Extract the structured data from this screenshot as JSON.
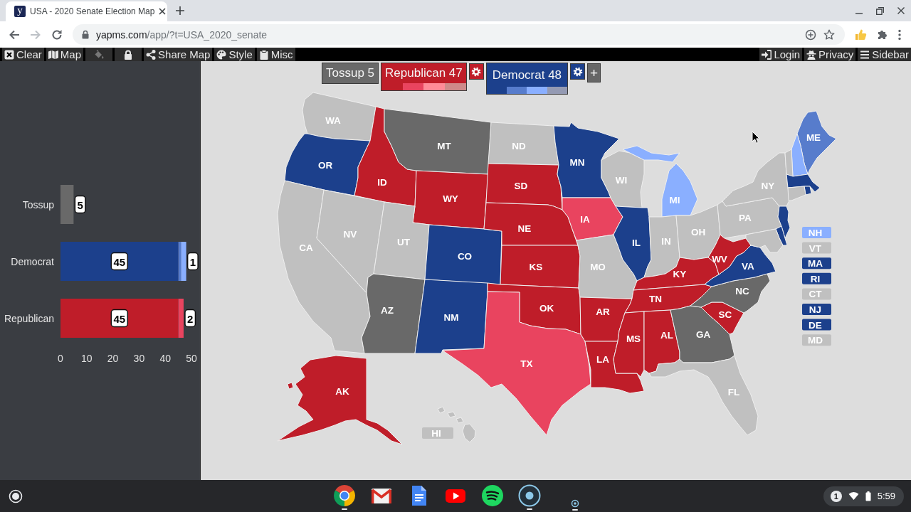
{
  "browser": {
    "tab": {
      "favicon_text": "y",
      "title": "USA - 2020 Senate Election Map"
    },
    "url_host": "yapms.com",
    "url_path": "/app/?t=USA_2020_senate"
  },
  "toolbar": {
    "left": [
      {
        "label": "Clear",
        "disabled": false
      },
      {
        "label": "Map",
        "disabled": false
      },
      {
        "disabled": true
      },
      {
        "disabled": false
      },
      {
        "label": "Share Map",
        "disabled": false
      },
      {
        "label": "Style",
        "disabled": false
      },
      {
        "label": "Misc",
        "disabled": false
      }
    ],
    "right": [
      {
        "label": "Login",
        "disabled": false
      },
      {
        "label": "Privacy",
        "disabled": false
      },
      {
        "label": "Sidebar",
        "disabled": false
      }
    ]
  },
  "sidebar": {
    "chart_data": {
      "type": "bar",
      "orientation": "horizontal",
      "stacked": true,
      "categories": [
        "Tossup",
        "Democrat",
        "Republican"
      ],
      "series": [
        {
          "color": "#696969",
          "values": [
            5,
            null,
            null
          ]
        },
        {
          "color": "#1c408c",
          "values": [
            null,
            45,
            null
          ]
        },
        {
          "color": "#577ccc",
          "values": [
            null,
            1,
            null
          ]
        },
        {
          "color": "#8aafff",
          "values": [
            null,
            2,
            null
          ]
        },
        {
          "color": "#bf1d29",
          "values": [
            null,
            null,
            45
          ]
        },
        {
          "color": "#e9445f",
          "values": [
            null,
            null,
            2
          ]
        }
      ],
      "xlim": [
        0,
        50
      ],
      "xticks": [
        0,
        10,
        20,
        30,
        40,
        50
      ],
      "value_labels": [
        [
          "5",
          null,
          null
        ],
        [
          null,
          "45",
          null
        ],
        [
          null,
          "1",
          null
        ],
        [
          null,
          null,
          null
        ],
        [
          null,
          null,
          "45"
        ],
        [
          null,
          null,
          "2"
        ]
      ]
    }
  },
  "map": {
    "legend": {
      "parties": [
        {
          "label": "Tossup 5",
          "color": "#696969",
          "selected": false,
          "settings": false
        },
        {
          "label": "Republican 47",
          "color": "#bf1d29",
          "selected": false,
          "settings": true,
          "swatches": [
            {
              "color": "#e9445f"
            },
            {
              "color": "#ff8b98"
            },
            {
              "color": "#cf8a8a"
            }
          ]
        },
        {
          "label": "Democrat 48",
          "color": "#1c408c",
          "selected": true,
          "settings": true,
          "swatches": [
            {
              "color": "#577ccc"
            },
            {
              "color": "#8aafff"
            },
            {
              "color": "#949ab3"
            }
          ]
        }
      ],
      "add_button": "+"
    },
    "states": [
      {
        "label": "WA",
        "color": "#c0c0c0",
        "kind": "inline"
      },
      {
        "label": "OR",
        "color": "#1c408c",
        "kind": "inline"
      },
      {
        "label": "CA",
        "color": "#c0c0c0",
        "kind": "inline"
      },
      {
        "label": "ID",
        "color": "#bf1d29",
        "kind": "inline"
      },
      {
        "label": "NV",
        "color": "#c0c0c0",
        "kind": "inline"
      },
      {
        "label": "MT",
        "color": "#696969",
        "kind": "inline"
      },
      {
        "label": "WY",
        "color": "#bf1d29",
        "kind": "inline"
      },
      {
        "label": "UT",
        "color": "#c0c0c0",
        "kind": "inline"
      },
      {
        "label": "AZ",
        "color": "#696969",
        "kind": "inline"
      },
      {
        "label": "CO",
        "color": "#1c408c",
        "kind": "inline"
      },
      {
        "label": "NM",
        "color": "#1c408c",
        "kind": "inline"
      },
      {
        "label": "ND",
        "color": "#c0c0c0",
        "kind": "inline"
      },
      {
        "label": "SD",
        "color": "#bf1d29",
        "kind": "inline"
      },
      {
        "label": "NE",
        "color": "#bf1d29",
        "kind": "inline"
      },
      {
        "label": "KS",
        "color": "#bf1d29",
        "kind": "inline"
      },
      {
        "label": "OK",
        "color": "#bf1d29",
        "kind": "inline"
      },
      {
        "label": "TX",
        "color": "#e9445f",
        "kind": "inline"
      },
      {
        "label": "MN",
        "color": "#1c408c",
        "kind": "inline"
      },
      {
        "label": "IA",
        "color": "#e9445f",
        "kind": "inline"
      },
      {
        "label": "MO",
        "color": "#c0c0c0",
        "kind": "inline"
      },
      {
        "label": "AR",
        "color": "#bf1d29",
        "kind": "inline"
      },
      {
        "label": "LA",
        "color": "#bf1d29",
        "kind": "inline"
      },
      {
        "label": "WI",
        "color": "#c0c0c0",
        "kind": "inline"
      },
      {
        "label": "IL",
        "color": "#1c408c",
        "kind": "inline"
      },
      {
        "label": "MI",
        "color": "#8aafff",
        "kind": "inline"
      },
      {
        "label": "IN",
        "color": "#c0c0c0",
        "kind": "inline"
      },
      {
        "label": "OH",
        "color": "#c0c0c0",
        "kind": "inline"
      },
      {
        "label": "KY",
        "color": "#bf1d29",
        "kind": "inline"
      },
      {
        "label": "TN",
        "color": "#bf1d29",
        "kind": "inline"
      },
      {
        "label": "MS",
        "color": "#bf1d29",
        "kind": "inline"
      },
      {
        "label": "AL",
        "color": "#bf1d29",
        "kind": "inline"
      },
      {
        "label": "GA",
        "color": "#696969",
        "kind": "inline"
      },
      {
        "label": "FL",
        "color": "#c0c0c0",
        "kind": "inline"
      },
      {
        "label": "SC",
        "color": "#bf1d29",
        "kind": "inline"
      },
      {
        "label": "NC",
        "color": "#696969",
        "kind": "inline"
      },
      {
        "label": "VA",
        "color": "#1c408c",
        "kind": "inline"
      },
      {
        "label": "WV",
        "color": "#bf1d29",
        "kind": "inline"
      },
      {
        "label": "PA",
        "color": "#c0c0c0",
        "kind": "inline"
      },
      {
        "label": "NY",
        "color": "#c0c0c0",
        "kind": "inline"
      },
      {
        "label": "ME",
        "color": "#577ccc",
        "kind": "inline"
      },
      {
        "label": "AK",
        "color": "#bf1d29",
        "kind": "inline"
      },
      {
        "label": "HI",
        "color": "#c0c0c0",
        "kind": "tag"
      },
      {
        "label": "NH",
        "color": "#8aafff",
        "kind": "boxed"
      },
      {
        "label": "VT",
        "color": "#c0c0c0",
        "kind": "boxed"
      },
      {
        "label": "MA",
        "color": "#1c408c",
        "kind": "boxed"
      },
      {
        "label": "RI",
        "color": "#1c408c",
        "kind": "boxed"
      },
      {
        "label": "CT",
        "color": "#c0c0c0",
        "kind": "boxed"
      },
      {
        "label": "NJ",
        "color": "#1c408c",
        "kind": "boxed"
      },
      {
        "label": "DE",
        "color": "#1c408c",
        "kind": "boxed"
      },
      {
        "label": "MD",
        "color": "#c0c0c0",
        "kind": "boxed"
      }
    ]
  },
  "taskbar": {
    "apps": [
      {
        "running": true
      },
      {
        "running": false
      },
      {
        "running": false
      },
      {
        "running": false
      },
      {
        "running": false
      },
      {
        "running": true
      },
      {
        "running": true
      }
    ],
    "tray": {
      "badge": "1",
      "time": "5:59"
    }
  }
}
